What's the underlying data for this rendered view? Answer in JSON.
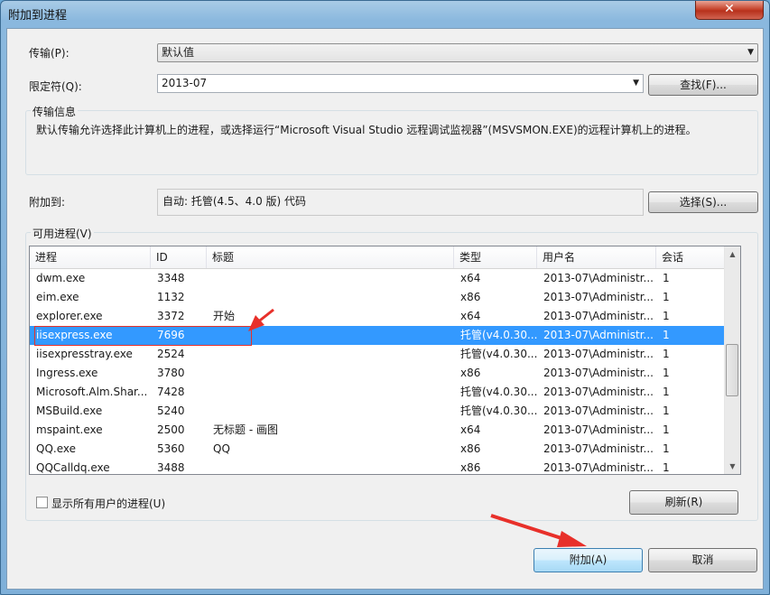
{
  "window": {
    "title": "附加到进程",
    "close_glyph": "✕"
  },
  "transport": {
    "label": "传输(P):",
    "value": "默认值"
  },
  "qualifier": {
    "label": "限定符(Q):",
    "value": "2013-07",
    "find_button": "查找(F)..."
  },
  "transport_info": {
    "title": "传输信息",
    "text": "默认传输允许选择此计算机上的进程，或选择运行“Microsoft Visual Studio 远程调试监视器”(MSVSMON.EXE)的远程计算机上的进程。"
  },
  "attach_to": {
    "label": "附加到:",
    "value": "自动: 托管(4.5、4.0 版) 代码",
    "select_button": "选择(S)..."
  },
  "processes": {
    "title": "可用进程(V)",
    "columns": [
      "进程",
      "ID",
      "标题",
      "类型",
      "用户名",
      "会话"
    ],
    "rows": [
      [
        "dwm.exe",
        "3348",
        "",
        "x64",
        "2013-07\\Administr...",
        "1"
      ],
      [
        "eim.exe",
        "1132",
        "",
        "x86",
        "2013-07\\Administr...",
        "1"
      ],
      [
        "explorer.exe",
        "3372",
        "开始",
        "x64",
        "2013-07\\Administr...",
        "1"
      ],
      [
        "iisexpress.exe",
        "7696",
        "",
        "托管(v4.0.30...",
        "2013-07\\Administr...",
        "1"
      ],
      [
        "iisexpresstray.exe",
        "2524",
        "",
        "托管(v4.0.30...",
        "2013-07\\Administr...",
        "1"
      ],
      [
        "Ingress.exe",
        "3780",
        "",
        "x86",
        "2013-07\\Administr...",
        "1"
      ],
      [
        "Microsoft.Alm.Shar...",
        "7428",
        "",
        "托管(v4.0.30...",
        "2013-07\\Administr...",
        "1"
      ],
      [
        "MSBuild.exe",
        "5240",
        "",
        "托管(v4.0.30...",
        "2013-07\\Administr...",
        "1"
      ],
      [
        "mspaint.exe",
        "2500",
        "无标题 - 画图",
        "x64",
        "2013-07\\Administr...",
        "1"
      ],
      [
        "QQ.exe",
        "5360",
        "QQ",
        "x86",
        "2013-07\\Administr...",
        "1"
      ],
      [
        "QQCalldq.exe",
        "3488",
        "",
        "x86",
        "2013-07\\Administr...",
        "1"
      ]
    ],
    "selected_index": 3
  },
  "show_all_users": {
    "label": "显示所有用户的进程(U)",
    "checked": false
  },
  "refresh_button": "刷新(R)",
  "attach_button": "附加(A)",
  "cancel_button": "取消",
  "colors": {
    "selection": "#3399ff",
    "annotation": "#e8302a"
  }
}
